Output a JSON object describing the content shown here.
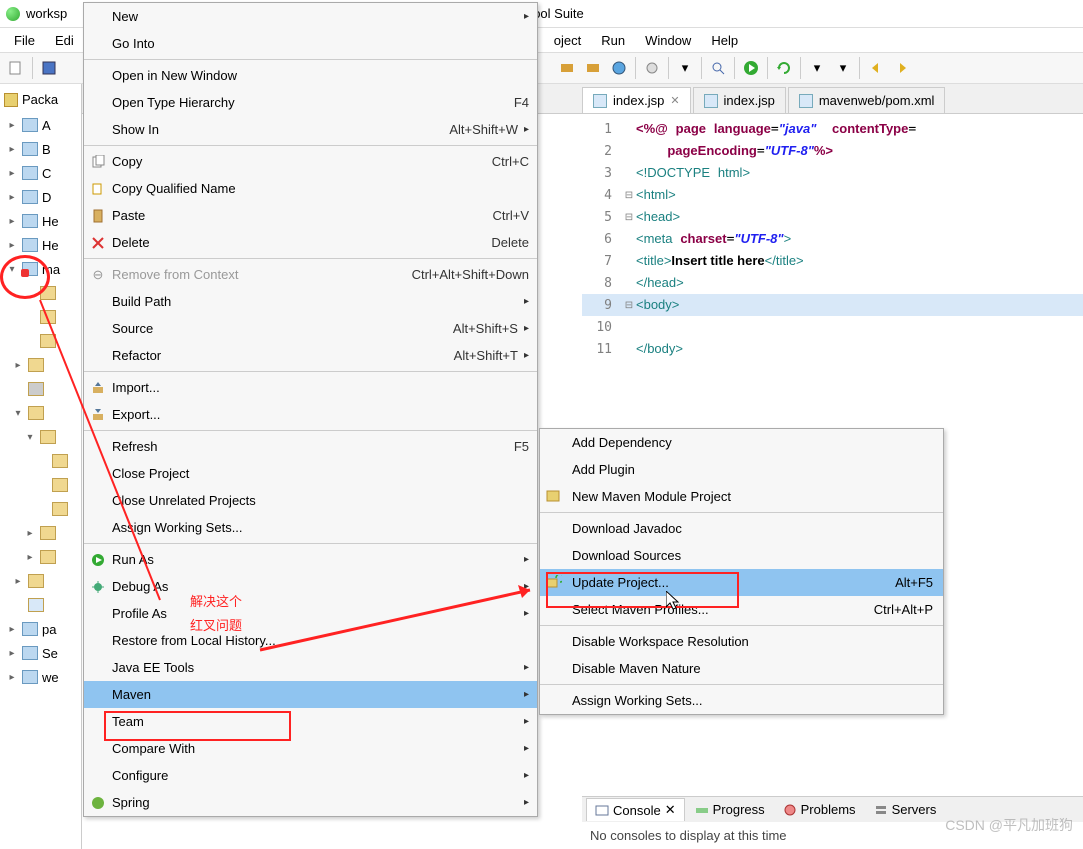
{
  "title": "worksp",
  "menubar": [
    "File",
    "Edi",
    "oject",
    "Run",
    "Window",
    "Help"
  ],
  "title_tail": "ool Suite",
  "sidebar": {
    "header": "Packa",
    "items": [
      "A",
      "B",
      "C",
      "D",
      "He",
      "He",
      "ma",
      "",
      "",
      "",
      "",
      "",
      "",
      "",
      "",
      "",
      "",
      "",
      "pa",
      "Se",
      "we"
    ]
  },
  "context": {
    "new": "New",
    "go_into": "Go Into",
    "open_new_window": "Open in New Window",
    "open_type_hierarchy": "Open Type Hierarchy",
    "open_type_hierarchy_s": "F4",
    "show_in": "Show In",
    "show_in_s": "Alt+Shift+W",
    "copy": "Copy",
    "copy_s": "Ctrl+C",
    "copy_qn": "Copy Qualified Name",
    "paste": "Paste",
    "paste_s": "Ctrl+V",
    "delete": "Delete",
    "delete_s": "Delete",
    "remove_ctx": "Remove from Context",
    "remove_ctx_s": "Ctrl+Alt+Shift+Down",
    "build_path": "Build Path",
    "source": "Source",
    "source_s": "Alt+Shift+S",
    "refactor": "Refactor",
    "refactor_s": "Alt+Shift+T",
    "import": "Import...",
    "export": "Export...",
    "refresh": "Refresh",
    "refresh_s": "F5",
    "close_project": "Close Project",
    "close_unrelated": "Close Unrelated Projects",
    "assign_ws": "Assign Working Sets...",
    "run_as": "Run As",
    "debug_as": "Debug As",
    "profile_as": "Profile As",
    "restore": "Restore from Local History...",
    "javaee": "Java EE Tools",
    "maven": "Maven",
    "team": "Team",
    "compare": "Compare With",
    "configure": "Configure",
    "spring": "Spring"
  },
  "submenu": {
    "add_dep": "Add Dependency",
    "add_plugin": "Add Plugin",
    "new_module": "New Maven Module Project",
    "dl_javadoc": "Download Javadoc",
    "dl_sources": "Download Sources",
    "update": "Update Project...",
    "update_s": "Alt+F5",
    "profiles": "Select Maven Profiles...",
    "profiles_s": "Ctrl+Alt+P",
    "disable_ws": "Disable Workspace Resolution",
    "disable_nature": "Disable Maven Nature",
    "assign_ws": "Assign Working Sets..."
  },
  "editor_tabs": [
    {
      "label": "index.jsp",
      "active": true
    },
    {
      "label": "index.jsp",
      "active": false
    },
    {
      "label": "mavenweb/pom.xml",
      "active": false
    }
  ],
  "code": {
    "l1a": "<%@",
    "l1b": "page",
    "l1c": "language",
    "l1d": "\"java\"",
    "l1e": "contentType",
    "l2a": "pageEncoding",
    "l2b": "\"UTF-8\"",
    "l2c": "%>",
    "l3": "<!DOCTYPE",
    "l3b": "html",
    "l3c": ">",
    "l4": "<html>",
    "l5": "<head>",
    "l6a": "<meta",
    "l6b": "charset",
    "l6c": "\"UTF-8\"",
    "l6d": ">",
    "l7a": "<title>",
    "l7b": "Insert title here",
    "l7c": "</title>",
    "l8": "</head>",
    "l9": "<body>",
    "l11": "</body>"
  },
  "console": {
    "tabs": [
      "Console",
      "Progress",
      "Problems",
      "Servers"
    ],
    "msg": "No consoles to display at this time"
  },
  "annotation": {
    "line1": "解决这个",
    "line2": "红叉问题"
  },
  "watermark": "CSDN @平凡加班狗"
}
